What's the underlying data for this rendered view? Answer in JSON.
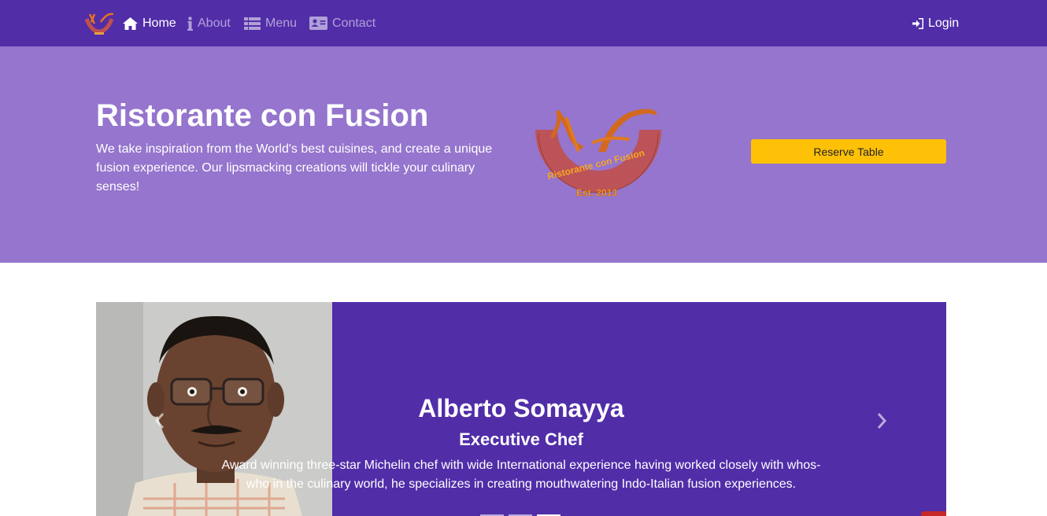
{
  "navbar": {
    "logo_icon": "ristorante-logo",
    "items": [
      {
        "label": "Home",
        "icon": "home-icon",
        "active": true
      },
      {
        "label": "About",
        "icon": "info-icon",
        "active": false
      },
      {
        "label": "Menu",
        "icon": "list-icon",
        "active": false
      },
      {
        "label": "Contact",
        "icon": "address-card-icon",
        "active": false
      }
    ],
    "login_label": "Login",
    "login_icon": "sign-in-icon"
  },
  "hero": {
    "title": "Ristorante con Fusion",
    "description": "We take inspiration from the World's best cuisines, and create a unique fusion experience. Our lipsmacking creations will tickle your culinary senses!",
    "logo_text": "Ristorante con Fusion",
    "logo_est": "Est. 2013",
    "reserve_label": "Reserve Table"
  },
  "carousel": {
    "name": "Alberto Somayya",
    "role": "Executive Chef",
    "description": "Award winning three-star Michelin chef with wide International experience having worked closely with whos-who in the culinary world, he specializes in creating mouthwatering Indo-Italian fusion experiences.",
    "prev_icon": "chevron-left-icon",
    "next_icon": "chevron-right-icon",
    "active_slide": 3
  },
  "colors": {
    "primary": "#512DA8",
    "primary_light": "#9575CD",
    "accent": "#FFC107"
  }
}
